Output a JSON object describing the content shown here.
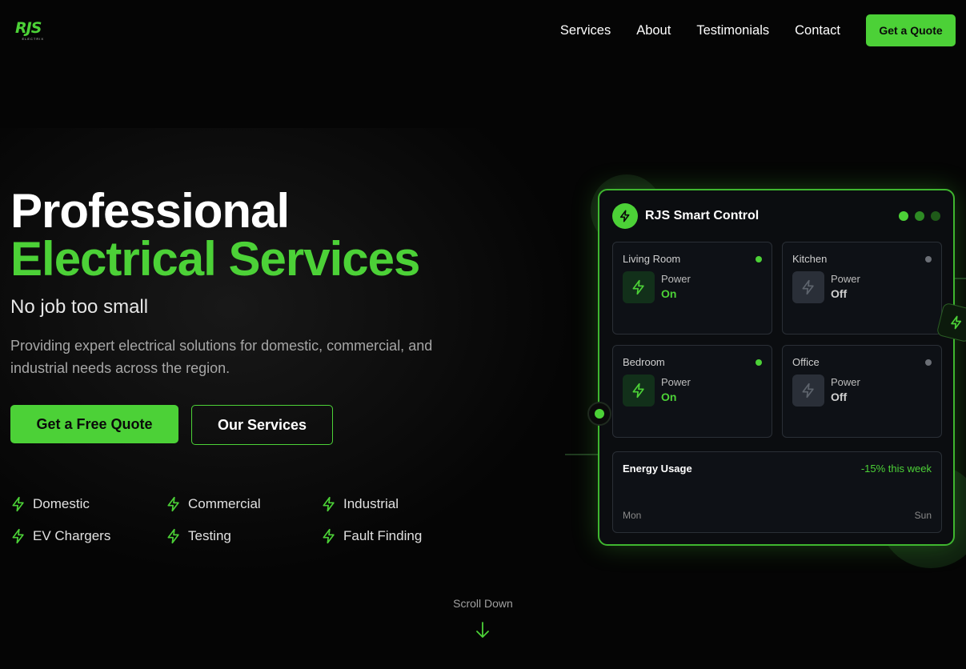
{
  "brand": {
    "logo_main": "RJS",
    "logo_sub": "ELECTRIX"
  },
  "nav": {
    "links": [
      "Services",
      "About",
      "Testimonials",
      "Contact"
    ],
    "cta": "Get a Quote"
  },
  "hero": {
    "title_line1": "Professional",
    "title_line2": "Electrical Services",
    "tagline": "No job too small",
    "description": "Providing expert electrical solutions for domestic, commercial, and industrial needs across the region.",
    "primary_button": "Get a Free Quote",
    "secondary_button": "Our Services",
    "features": [
      "Domestic",
      "Commercial",
      "Industrial",
      "EV Chargers",
      "Testing",
      "Fault Finding"
    ],
    "scroll_label": "Scroll Down"
  },
  "panel": {
    "title": "RJS Smart Control",
    "rooms": [
      {
        "name": "Living Room",
        "label": "Power",
        "state": "On"
      },
      {
        "name": "Kitchen",
        "label": "Power",
        "state": "Off"
      },
      {
        "name": "Bedroom",
        "label": "Power",
        "state": "On"
      },
      {
        "name": "Office",
        "label": "Power",
        "state": "Off"
      }
    ],
    "energy": {
      "title": "Energy Usage",
      "trend": "-15% this week",
      "start": "Mon",
      "end": "Sun"
    }
  },
  "colors": {
    "accent": "#4cd137",
    "background": "#050505",
    "card": "#0b0d10",
    "on_icon_bg": "#12301a",
    "off_icon_bg": "#2a2f38",
    "off_text": "#d0d0d0",
    "inactive_dot": "#6b6f76"
  },
  "icons": {
    "feature": "lightning-bolt-icon",
    "room": "lightning-bolt-icon",
    "scroll": "arrow-down-icon"
  }
}
